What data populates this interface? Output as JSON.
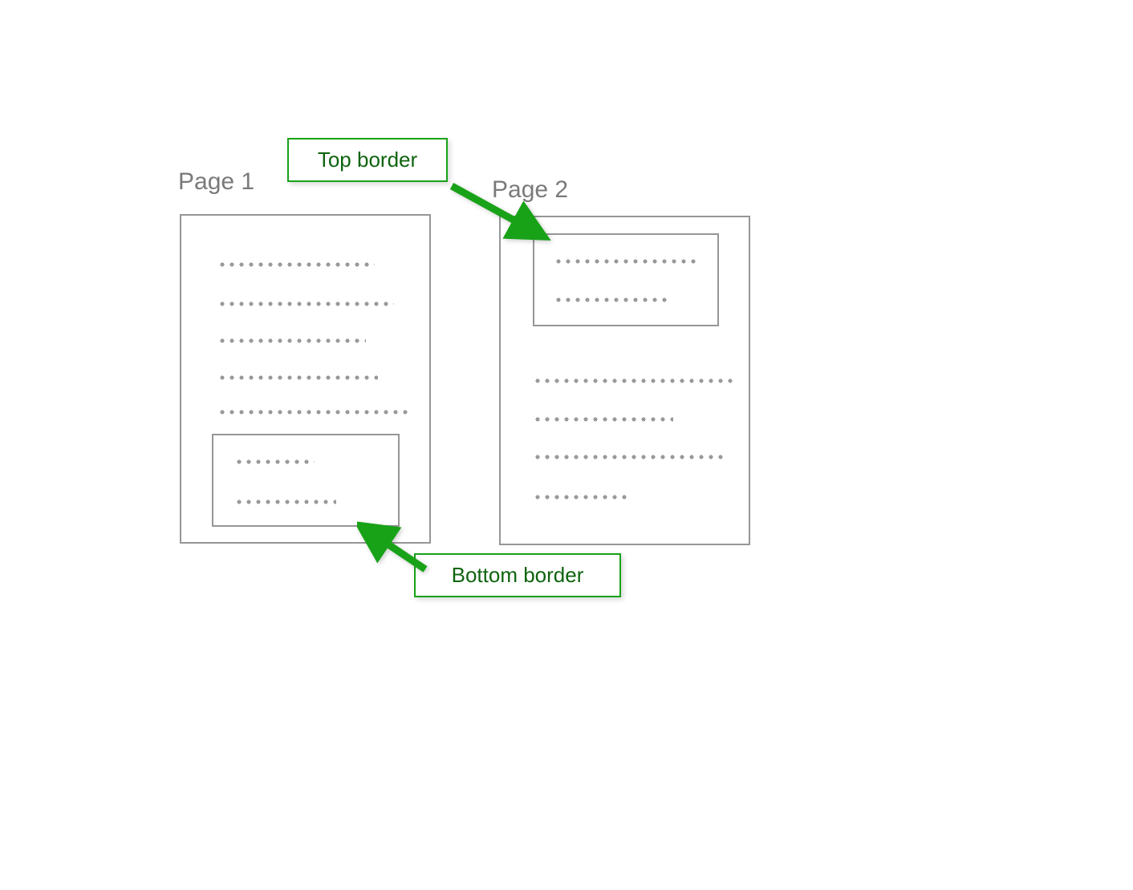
{
  "labels": {
    "page1": "Page 1",
    "page2": "Page 2",
    "top_border": "Top border",
    "bottom_border": "Bottom border"
  },
  "colors": {
    "border": "#969696",
    "text": "#7a7a7a",
    "accent": "#18a218",
    "accent_text": "#0f640f"
  }
}
